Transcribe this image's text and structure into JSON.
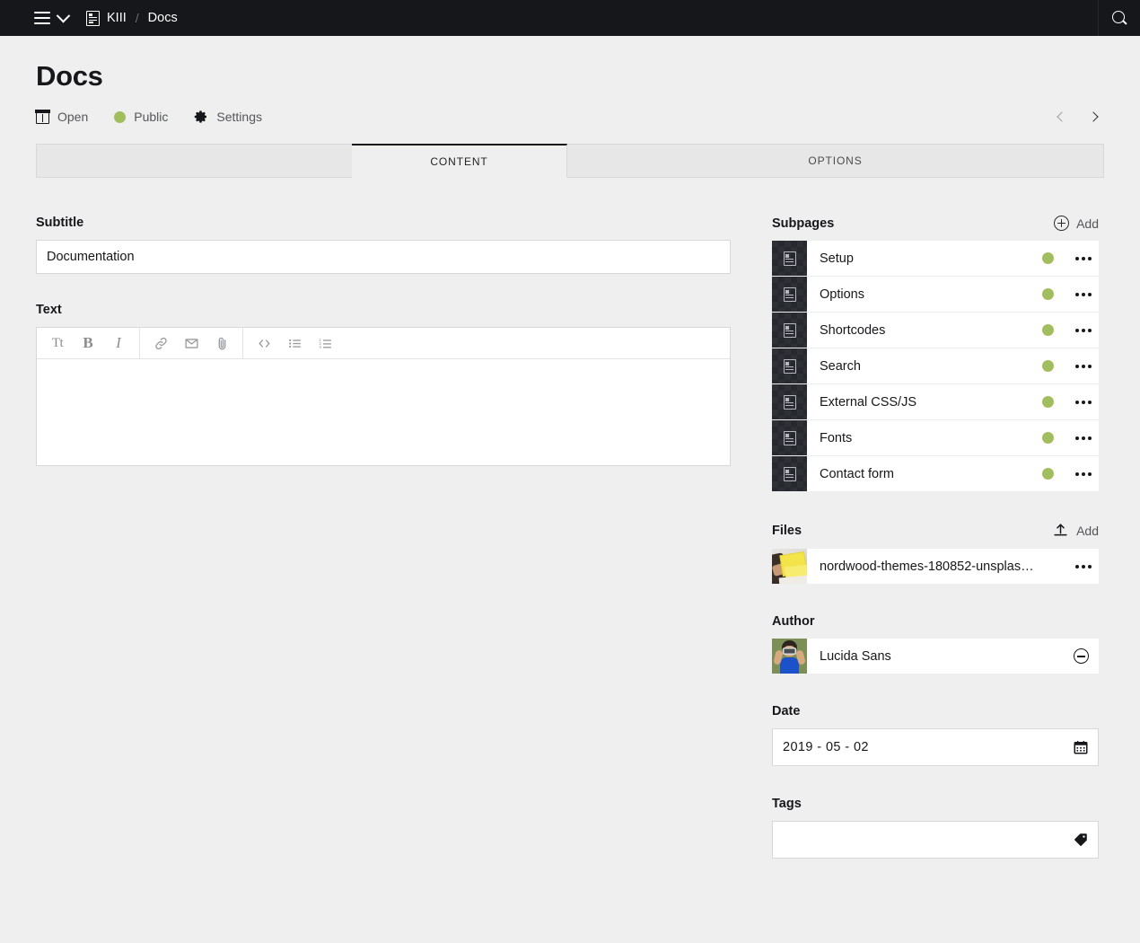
{
  "topbar": {
    "menu_icon": "hamburger-icon",
    "menu_chevron_icon": "chevron-down-icon",
    "site_icon": "page-icon",
    "site_label": "KIII",
    "separator": "/",
    "current_label": "Docs",
    "search_icon": "search-icon"
  },
  "header": {
    "title": "Docs",
    "meta": [
      {
        "icon": "open-preview-icon",
        "label": "Open"
      },
      {
        "icon": "status-dot-icon",
        "label": "Public",
        "color": "#a2bd5e"
      },
      {
        "icon": "gear-icon",
        "label": "Settings"
      }
    ],
    "prev_icon": "chevron-left-icon",
    "next_icon": "chevron-right-icon"
  },
  "tabs": [
    {
      "label": "Content",
      "active": true
    },
    {
      "label": "Options",
      "active": false
    }
  ],
  "main": {
    "subtitle": {
      "label": "Subtitle",
      "value": "Documentation",
      "placeholder": ""
    },
    "text": {
      "label": "Text",
      "value": "",
      "placeholder": "",
      "toolbar": [
        {
          "icon": "headline-icon",
          "label": "Tt"
        },
        {
          "icon": "bold-icon",
          "label": "B"
        },
        {
          "icon": "italic-icon",
          "label": "I"
        },
        {
          "icon": "link-icon",
          "label": ""
        },
        {
          "icon": "email-icon",
          "label": ""
        },
        {
          "icon": "attachment-icon",
          "label": ""
        },
        {
          "icon": "code-icon",
          "label": ""
        },
        {
          "icon": "bullet-list-icon",
          "label": ""
        },
        {
          "icon": "ordered-list-icon",
          "label": ""
        }
      ]
    }
  },
  "sidebar": {
    "subpages": {
      "title": "Subpages",
      "add_label": "Add",
      "add_icon": "plus-circle-icon",
      "items": [
        {
          "icon": "page-icon",
          "label": "Setup",
          "status": "public",
          "status_color": "#a2bd5e",
          "options_icon": "ellipsis-icon"
        },
        {
          "icon": "page-icon",
          "label": "Options",
          "status": "public",
          "status_color": "#a2bd5e",
          "options_icon": "ellipsis-icon"
        },
        {
          "icon": "page-icon",
          "label": "Shortcodes",
          "status": "public",
          "status_color": "#a2bd5e",
          "options_icon": "ellipsis-icon"
        },
        {
          "icon": "page-icon",
          "label": "Search",
          "status": "public",
          "status_color": "#a2bd5e",
          "options_icon": "ellipsis-icon"
        },
        {
          "icon": "page-icon",
          "label": "External CSS/JS",
          "status": "public",
          "status_color": "#a2bd5e",
          "options_icon": "ellipsis-icon"
        },
        {
          "icon": "page-icon",
          "label": "Fonts",
          "status": "public",
          "status_color": "#a2bd5e",
          "options_icon": "ellipsis-icon"
        },
        {
          "icon": "page-icon",
          "label": "Contact form",
          "status": "public",
          "status_color": "#a2bd5e",
          "options_icon": "ellipsis-icon"
        }
      ]
    },
    "files": {
      "title": "Files",
      "add_label": "Add",
      "add_icon": "upload-icon",
      "items": [
        {
          "thumbnail": "photo-thumbnail",
          "label": "nordwood-themes-180852-unsplas…",
          "options_icon": "ellipsis-icon"
        }
      ]
    },
    "author": {
      "title": "Author",
      "items": [
        {
          "avatar": "user-avatar",
          "label": "Lucida Sans",
          "remove_icon": "minus-circle-icon"
        }
      ]
    },
    "date": {
      "title": "Date",
      "value": "2019 - 05 - 02",
      "placeholder": "",
      "icon": "calendar-icon"
    },
    "tags": {
      "title": "Tags",
      "value": "",
      "placeholder": "",
      "icon": "tag-icon"
    }
  }
}
